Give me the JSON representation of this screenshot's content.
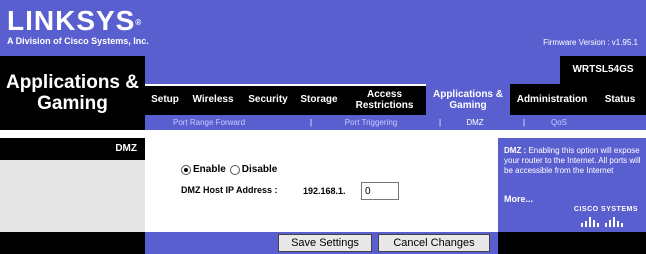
{
  "brand": {
    "logo": "LINKSYS",
    "logo_mark": "®",
    "tagline": "A Division of Cisco Systems, Inc."
  },
  "firmware": {
    "label": "Firmware Version :",
    "value": "v1.95.1"
  },
  "page_title": "Applications & Gaming",
  "model": "WRTSL54GS",
  "tabs": [
    {
      "label": "Setup"
    },
    {
      "label": "Wireless"
    },
    {
      "label": "Security"
    },
    {
      "label": "Storage"
    },
    {
      "label": "Access Restrictions"
    },
    {
      "label": "Applications & Gaming",
      "active": true
    },
    {
      "label": "Administration"
    },
    {
      "label": "Status"
    }
  ],
  "subtabs": [
    {
      "label": "Port Range Forward"
    },
    {
      "label": "Port Triggering"
    },
    {
      "label": "DMZ",
      "active": true
    },
    {
      "label": "QoS"
    }
  ],
  "subtab_separator": "|",
  "section_title": "DMZ",
  "dmz": {
    "enable_label": "Enable",
    "disable_label": "Disable",
    "selected": "enable",
    "host_ip_label": "DMZ Host IP Address :",
    "ip_prefix": "192.168.1.",
    "ip_last_octet": "0"
  },
  "help": {
    "term": "DMZ :",
    "text": " Enabling this option will expose your router to the Internet. All ports will be accessible from the Internet",
    "more": "More...",
    "vendor": "CISCO SYSTEMS"
  },
  "buttons": {
    "save": "Save Settings",
    "cancel": "Cancel Changes"
  },
  "colors": {
    "accent": "#5a5fd0",
    "header_black": "#000000",
    "sidebar_gray": "#e6e6e6"
  }
}
